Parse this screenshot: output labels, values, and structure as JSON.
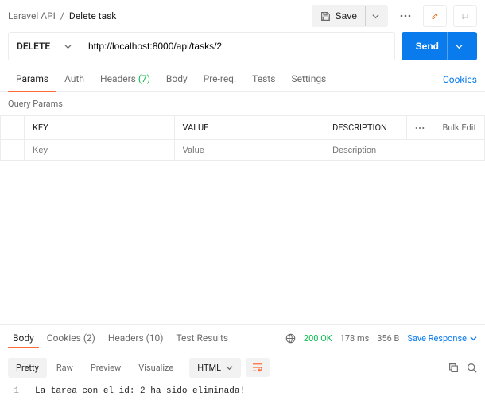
{
  "breadcrumb": {
    "collection": "Laravel API",
    "sep": "/",
    "request": "Delete task"
  },
  "header": {
    "save": "Save"
  },
  "method": "DELETE",
  "url": "http://localhost:8000/api/tasks/2",
  "send": "Send",
  "tabs": {
    "params": "Params",
    "auth": "Auth",
    "headers": "Headers",
    "headers_count": "(7)",
    "body": "Body",
    "prereq": "Pre-req.",
    "tests": "Tests",
    "settings": "Settings",
    "cookies": "Cookies"
  },
  "query_params": {
    "title": "Query Params",
    "cols": {
      "key": "KEY",
      "value": "VALUE",
      "desc": "DESCRIPTION",
      "bulk": "Bulk Edit"
    },
    "placeholders": {
      "key": "Key",
      "value": "Value",
      "desc": "Description"
    }
  },
  "response": {
    "tabs": {
      "body": "Body",
      "cookies": "Cookies",
      "cookies_count": "(2)",
      "headers": "Headers",
      "headers_count": "(10)",
      "tests": "Test Results"
    },
    "status": "200 OK",
    "time": "178 ms",
    "size": "356 B",
    "save": "Save Response",
    "views": {
      "pretty": "Pretty",
      "raw": "Raw",
      "preview": "Preview",
      "visualize": "Visualize"
    },
    "format": "HTML",
    "line": "1",
    "body_text": "La tarea con el id: 2 ha sido eliminada!"
  }
}
